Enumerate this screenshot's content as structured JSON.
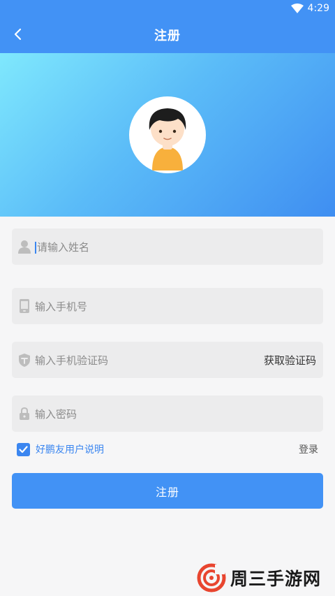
{
  "status_bar": {
    "time": "4:29"
  },
  "header": {
    "title": "注册"
  },
  "form": {
    "name_placeholder": "请输入姓名",
    "phone_placeholder": "输入手机号",
    "code_placeholder": "输入手机验证码",
    "get_code_label": "获取验证码",
    "password_placeholder": "输入密码"
  },
  "agreement": {
    "checked": true,
    "label": "好鹏友用户说明",
    "login_label": "登录"
  },
  "submit_label": "注册",
  "watermark": {
    "text": "周三手游网"
  },
  "colors": {
    "primary": "#4292f5",
    "link": "#3b86f0",
    "field_bg": "#ececed"
  }
}
